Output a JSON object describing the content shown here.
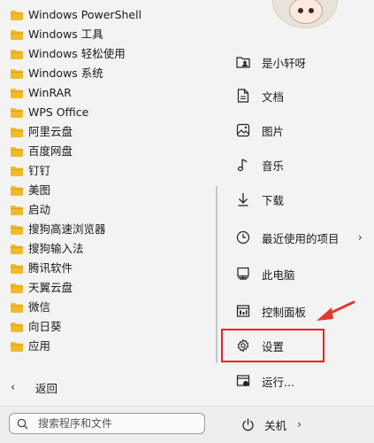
{
  "apps": [
    "Windows PowerShell",
    "Windows 工具",
    "Windows 轻松使用",
    "Windows 系统",
    "WinRAR",
    "WPS Office",
    "阿里云盘",
    "百度网盘",
    "钉钉",
    "美图",
    "启动",
    "搜狗高速浏览器",
    "搜狗输入法",
    "腾讯软件",
    "天翼云盘",
    "微信",
    "向日葵",
    "应用"
  ],
  "back_label": "返回",
  "nav": {
    "user": "是小轩呀",
    "documents": "文档",
    "pictures": "图片",
    "music": "音乐",
    "downloads": "下载",
    "recent": "最近使用的项目",
    "this_pc": "此电脑",
    "control_panel": "控制面板",
    "settings": "设置",
    "run": "运行..."
  },
  "search": {
    "placeholder": "搜索程序和文件"
  },
  "power": {
    "label": "关机"
  },
  "colors": {
    "folder": "#f0bb2a",
    "highlight": "#e1251b",
    "arrow": "#e23a2f"
  }
}
